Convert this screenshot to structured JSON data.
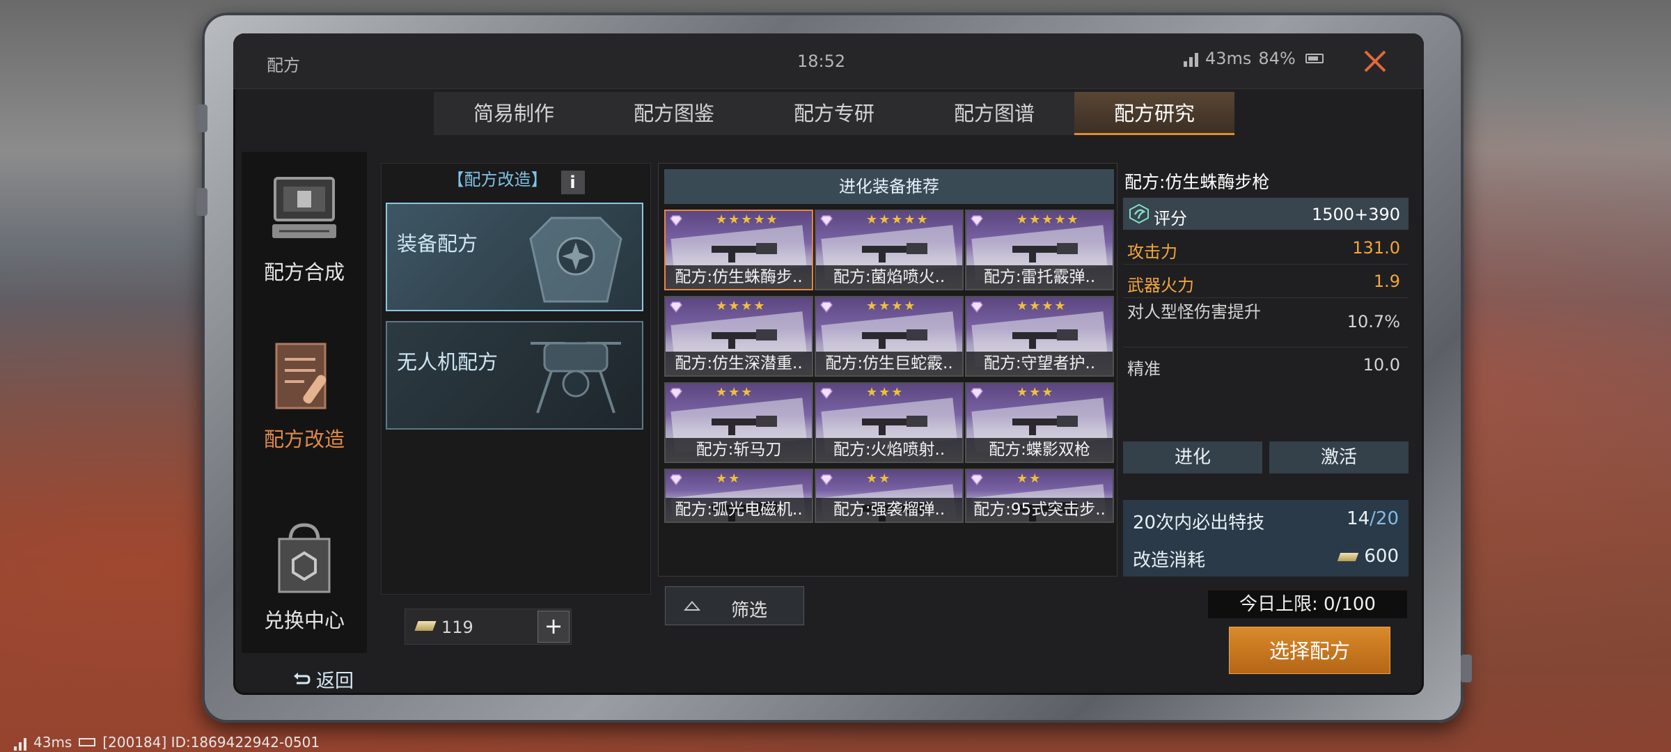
{
  "status_bar": {
    "title": "配方",
    "clock": "18:52",
    "ping": "43ms",
    "battery": "84%"
  },
  "tabs": [
    {
      "label": "简易制作",
      "active": false
    },
    {
      "label": "配方图鉴",
      "active": false
    },
    {
      "label": "配方专研",
      "active": false
    },
    {
      "label": "配方图谱",
      "active": false
    },
    {
      "label": "配方研究",
      "active": true
    }
  ],
  "sidebar": {
    "items": [
      {
        "label": "配方合成",
        "icon": "terminal-icon",
        "active": false
      },
      {
        "label": "配方改造",
        "icon": "document-bullet-icon",
        "active": true
      },
      {
        "label": "兑换中心",
        "icon": "shopping-bag-icon",
        "active": false
      }
    ]
  },
  "category_panel": {
    "header": "【配方改造】",
    "info_label": "i",
    "items": [
      {
        "label": "装备配方",
        "active": true
      },
      {
        "label": "无人机配方",
        "active": false
      }
    ]
  },
  "currency": {
    "value": "119",
    "plus_label": "+"
  },
  "grid": {
    "header": "进化装备推荐",
    "cards": [
      {
        "name": "配方:仿生蛛酶步..",
        "stars": "★★★★★",
        "active": true
      },
      {
        "name": "配方:菌焰喷火..",
        "stars": "★★★★★",
        "active": false
      },
      {
        "name": "配方:雷托霰弹..",
        "stars": "★★★★★",
        "active": false
      },
      {
        "name": "配方:仿生深潜重..",
        "stars": "★★★★",
        "active": false
      },
      {
        "name": "配方:仿生巨蛇霰..",
        "stars": "★★★★",
        "active": false
      },
      {
        "name": "配方:守望者护..",
        "stars": "★★★★",
        "active": false
      },
      {
        "name": "配方:斩马刀",
        "stars": "★★★",
        "active": false
      },
      {
        "name": "配方:火焰喷射..",
        "stars": "★★★",
        "active": false
      },
      {
        "name": "配方:蝶影双枪",
        "stars": "★★★",
        "active": false
      },
      {
        "name": "配方:弧光电磁机..",
        "stars": "★★",
        "active": false
      },
      {
        "name": "配方:强袭榴弹..",
        "stars": "★★",
        "active": false
      },
      {
        "name": "配方:95式突击步..",
        "stars": "★★",
        "active": false
      }
    ]
  },
  "filter_label": "筛选",
  "detail": {
    "recipe_name": "配方:仿生蛛酶步枪",
    "score_label": "评分",
    "score_value": "1500+390",
    "stats": [
      {
        "label": "攻击力",
        "value": "131.0",
        "style": "orange"
      },
      {
        "label": "武器火力",
        "value": "1.9",
        "style": "orange"
      },
      {
        "label": "对人型怪伤害提升",
        "value": "10.7%",
        "style": "plain"
      },
      {
        "label": "精准",
        "value": "10.0",
        "style": "plain"
      }
    ],
    "evolve_label": "进化",
    "activate_label": "激活",
    "pity_label": "20次内必出特技",
    "pity_current": "14",
    "pity_max": "/20",
    "cost_label": "改造消耗",
    "cost_value": "600"
  },
  "daily_limit": "今日上限: 0/100",
  "select_button": "选择配方",
  "back_label": "返回",
  "bottom_status": {
    "ping": "43ms",
    "id_text": "[200184] ID:1869422942-0501"
  },
  "colors": {
    "accent_orange": "#e38a35",
    "stat_orange": "#f2a63c",
    "info_blue": "#7fc2e8",
    "card_purple": "#5b4680",
    "close_red": "#e06a3a"
  }
}
